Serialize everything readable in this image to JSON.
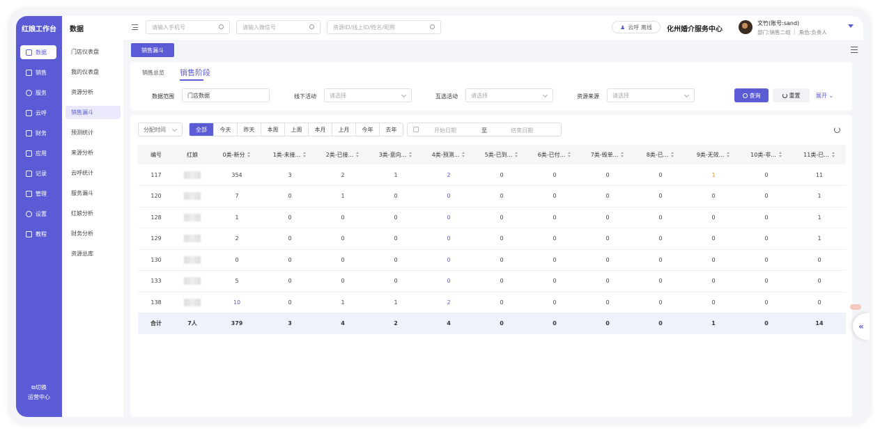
{
  "sidebar": {
    "title": "红娘工作台",
    "items": [
      {
        "label": "数据",
        "icon": "data-icon"
      },
      {
        "label": "销售",
        "icon": "sales-icon"
      },
      {
        "label": "服务",
        "icon": "heart-icon"
      },
      {
        "label": "云呼",
        "icon": "phone-icon"
      },
      {
        "label": "财务",
        "icon": "wallet-icon"
      },
      {
        "label": "应用",
        "icon": "apps-icon"
      },
      {
        "label": "记录",
        "icon": "record-icon"
      },
      {
        "label": "管理",
        "icon": "manage-icon"
      },
      {
        "label": "设置",
        "icon": "gear-icon"
      },
      {
        "label": "教程",
        "icon": "book-icon"
      }
    ],
    "switch_line1": "切换",
    "switch_line2": "运营中心"
  },
  "subnav": {
    "title": "数据",
    "items": [
      "门店仪表盘",
      "我的仪表盘",
      "资源分析",
      "销售漏斗",
      "预测统计",
      "来源分析",
      "云呼统计",
      "服务漏斗",
      "红娘分析",
      "财务分析",
      "资源总库"
    ]
  },
  "topbar": {
    "phone_placeholder": "请输入手机号",
    "wechat_placeholder": "请输入微信号",
    "resource_placeholder": "资源ID/线上ID/姓名/昵称",
    "yunhu_status": "云呼 离线",
    "center_name": "化州婚介服务中心",
    "user_name": "文竹(账号:sand)",
    "user_dept": "部门:销售二组 ｜ 角色:负责人"
  },
  "page_tab": "销售漏斗",
  "subtabs": [
    "销售总览",
    "销售阶段"
  ],
  "filters": {
    "scope_label": "数据范围",
    "scope_value": "门店数据",
    "offline_label": "线下活动",
    "offline_placeholder": "请选择",
    "mutual_label": "互选活动",
    "mutual_placeholder": "请选择",
    "source_label": "资源来源",
    "source_placeholder": "请选择",
    "query": "查询",
    "reset": "重置",
    "expand": "展开"
  },
  "time": {
    "select": "分配时间",
    "ranges": [
      "全部",
      "今天",
      "昨天",
      "本周",
      "上周",
      "本月",
      "上月",
      "今年",
      "去年"
    ],
    "start_placeholder": "开始日期",
    "to": "至",
    "end_placeholder": "结束日期"
  },
  "table": {
    "headers": [
      "编号",
      "红娘",
      "0类-新分",
      "1类-未接...",
      "2类-已接...",
      "3类-意向...",
      "4类-预测...",
      "5类-已到...",
      "6类-已付...",
      "7类-毁单...",
      "8类-已...",
      "9类-无效...",
      "10类-非...",
      "11类-已..."
    ],
    "rows": [
      [
        "117",
        "",
        "354",
        "3",
        "2",
        "1",
        "2",
        "0",
        "0",
        "0",
        "0",
        "1",
        "0",
        "11"
      ],
      [
        "120",
        "",
        "7",
        "0",
        "1",
        "0",
        "0",
        "0",
        "0",
        "0",
        "0",
        "0",
        "0",
        "1"
      ],
      [
        "128",
        "",
        "1",
        "0",
        "0",
        "0",
        "0",
        "0",
        "0",
        "0",
        "0",
        "0",
        "0",
        "1"
      ],
      [
        "129",
        "",
        "2",
        "0",
        "0",
        "0",
        "0",
        "0",
        "0",
        "0",
        "0",
        "0",
        "0",
        "1"
      ],
      [
        "130",
        "",
        "0",
        "0",
        "0",
        "0",
        "0",
        "0",
        "0",
        "0",
        "0",
        "0",
        "0",
        "0"
      ],
      [
        "133",
        "",
        "5",
        "0",
        "0",
        "0",
        "0",
        "0",
        "0",
        "0",
        "0",
        "0",
        "0",
        "0"
      ],
      [
        "138",
        "",
        "10",
        "0",
        "1",
        "1",
        "2",
        "0",
        "0",
        "0",
        "0",
        "0",
        "0",
        "0"
      ]
    ],
    "total": [
      "合计",
      "7人",
      "379",
      "3",
      "4",
      "2",
      "4",
      "0",
      "0",
      "0",
      "0",
      "1",
      "0",
      "14"
    ]
  },
  "colors": {
    "accent": "#5b5bd6",
    "highlight": "#e8912e"
  }
}
